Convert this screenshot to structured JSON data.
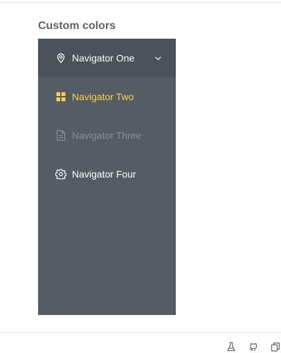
{
  "section": {
    "title": "Custom colors"
  },
  "menu": {
    "background": "#545c64",
    "text_color": "#ffffff",
    "active_text_color": "#ffd04b",
    "disabled_text_color": "#8b9095",
    "items": [
      {
        "label": "Navigator One",
        "icon": "location-icon",
        "expanded": true,
        "has_submenu": true
      },
      {
        "label": "Navigator Two",
        "icon": "menu-grid-icon",
        "active": true
      },
      {
        "label": "Navigator Three",
        "icon": "document-icon",
        "disabled": true
      },
      {
        "label": "Navigator Four",
        "icon": "setting-icon"
      }
    ]
  },
  "footer": {
    "actions": [
      {
        "icon": "flask-icon"
      },
      {
        "icon": "github-icon"
      },
      {
        "icon": "copy-icon"
      }
    ]
  }
}
